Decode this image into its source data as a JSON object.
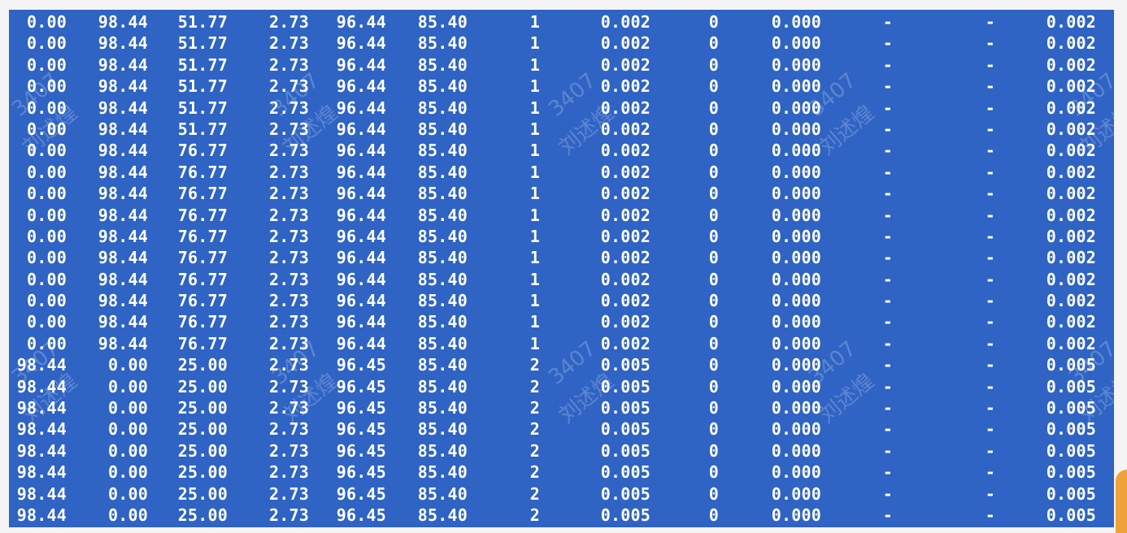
{
  "terminal": {
    "rows": [
      [
        "0.00",
        "98.44",
        "51.77",
        "2.73",
        "96.44",
        "85.40",
        "1",
        "0.002",
        "0",
        "0.000",
        "-",
        "-",
        "0.002"
      ],
      [
        "0.00",
        "98.44",
        "51.77",
        "2.73",
        "96.44",
        "85.40",
        "1",
        "0.002",
        "0",
        "0.000",
        "-",
        "-",
        "0.002"
      ],
      [
        "0.00",
        "98.44",
        "51.77",
        "2.73",
        "96.44",
        "85.40",
        "1",
        "0.002",
        "0",
        "0.000",
        "-",
        "-",
        "0.002"
      ],
      [
        "0.00",
        "98.44",
        "51.77",
        "2.73",
        "96.44",
        "85.40",
        "1",
        "0.002",
        "0",
        "0.000",
        "-",
        "-",
        "0.002"
      ],
      [
        "0.00",
        "98.44",
        "51.77",
        "2.73",
        "96.44",
        "85.40",
        "1",
        "0.002",
        "0",
        "0.000",
        "-",
        "-",
        "0.002"
      ],
      [
        "0.00",
        "98.44",
        "51.77",
        "2.73",
        "96.44",
        "85.40",
        "1",
        "0.002",
        "0",
        "0.000",
        "-",
        "-",
        "0.002"
      ],
      [
        "0.00",
        "98.44",
        "76.77",
        "2.73",
        "96.44",
        "85.40",
        "1",
        "0.002",
        "0",
        "0.000",
        "-",
        "-",
        "0.002"
      ],
      [
        "0.00",
        "98.44",
        "76.77",
        "2.73",
        "96.44",
        "85.40",
        "1",
        "0.002",
        "0",
        "0.000",
        "-",
        "-",
        "0.002"
      ],
      [
        "0.00",
        "98.44",
        "76.77",
        "2.73",
        "96.44",
        "85.40",
        "1",
        "0.002",
        "0",
        "0.000",
        "-",
        "-",
        "0.002"
      ],
      [
        "0.00",
        "98.44",
        "76.77",
        "2.73",
        "96.44",
        "85.40",
        "1",
        "0.002",
        "0",
        "0.000",
        "-",
        "-",
        "0.002"
      ],
      [
        "0.00",
        "98.44",
        "76.77",
        "2.73",
        "96.44",
        "85.40",
        "1",
        "0.002",
        "0",
        "0.000",
        "-",
        "-",
        "0.002"
      ],
      [
        "0.00",
        "98.44",
        "76.77",
        "2.73",
        "96.44",
        "85.40",
        "1",
        "0.002",
        "0",
        "0.000",
        "-",
        "-",
        "0.002"
      ],
      [
        "0.00",
        "98.44",
        "76.77",
        "2.73",
        "96.44",
        "85.40",
        "1",
        "0.002",
        "0",
        "0.000",
        "-",
        "-",
        "0.002"
      ],
      [
        "0.00",
        "98.44",
        "76.77",
        "2.73",
        "96.44",
        "85.40",
        "1",
        "0.002",
        "0",
        "0.000",
        "-",
        "-",
        "0.002"
      ],
      [
        "0.00",
        "98.44",
        "76.77",
        "2.73",
        "96.44",
        "85.40",
        "1",
        "0.002",
        "0",
        "0.000",
        "-",
        "-",
        "0.002"
      ],
      [
        "0.00",
        "98.44",
        "76.77",
        "2.73",
        "96.44",
        "85.40",
        "1",
        "0.002",
        "0",
        "0.000",
        "-",
        "-",
        "0.002"
      ],
      [
        "98.44",
        "0.00",
        "25.00",
        "2.73",
        "96.45",
        "85.40",
        "2",
        "0.005",
        "0",
        "0.000",
        "-",
        "-",
        "0.005"
      ],
      [
        "98.44",
        "0.00",
        "25.00",
        "2.73",
        "96.45",
        "85.40",
        "2",
        "0.005",
        "0",
        "0.000",
        "-",
        "-",
        "0.005"
      ],
      [
        "98.44",
        "0.00",
        "25.00",
        "2.73",
        "96.45",
        "85.40",
        "2",
        "0.005",
        "0",
        "0.000",
        "-",
        "-",
        "0.005"
      ],
      [
        "98.44",
        "0.00",
        "25.00",
        "2.73",
        "96.45",
        "85.40",
        "2",
        "0.005",
        "0",
        "0.000",
        "-",
        "-",
        "0.005"
      ],
      [
        "98.44",
        "0.00",
        "25.00",
        "2.73",
        "96.45",
        "85.40",
        "2",
        "0.005",
        "0",
        "0.000",
        "-",
        "-",
        "0.005"
      ],
      [
        "98.44",
        "0.00",
        "25.00",
        "2.73",
        "96.45",
        "85.40",
        "2",
        "0.005",
        "0",
        "0.000",
        "-",
        "-",
        "0.005"
      ],
      [
        "98.44",
        "0.00",
        "25.00",
        "2.73",
        "96.45",
        "85.40",
        "2",
        "0.005",
        "0",
        "0.000",
        "-",
        "-",
        "0.005"
      ],
      [
        "98.44",
        "0.00",
        "25.00",
        "2.73",
        "96.45",
        "85.40",
        "2",
        "0.005",
        "0",
        "0.000",
        "-",
        "-",
        "0.005"
      ]
    ]
  },
  "watermark": {
    "id_text": "3407",
    "name_text": "刘述煌"
  },
  "colors": {
    "terminal_background": "#2f63c4",
    "text": "#ffffff",
    "page_background": "#f4f4f4",
    "side_tab": "#f0a23a"
  }
}
